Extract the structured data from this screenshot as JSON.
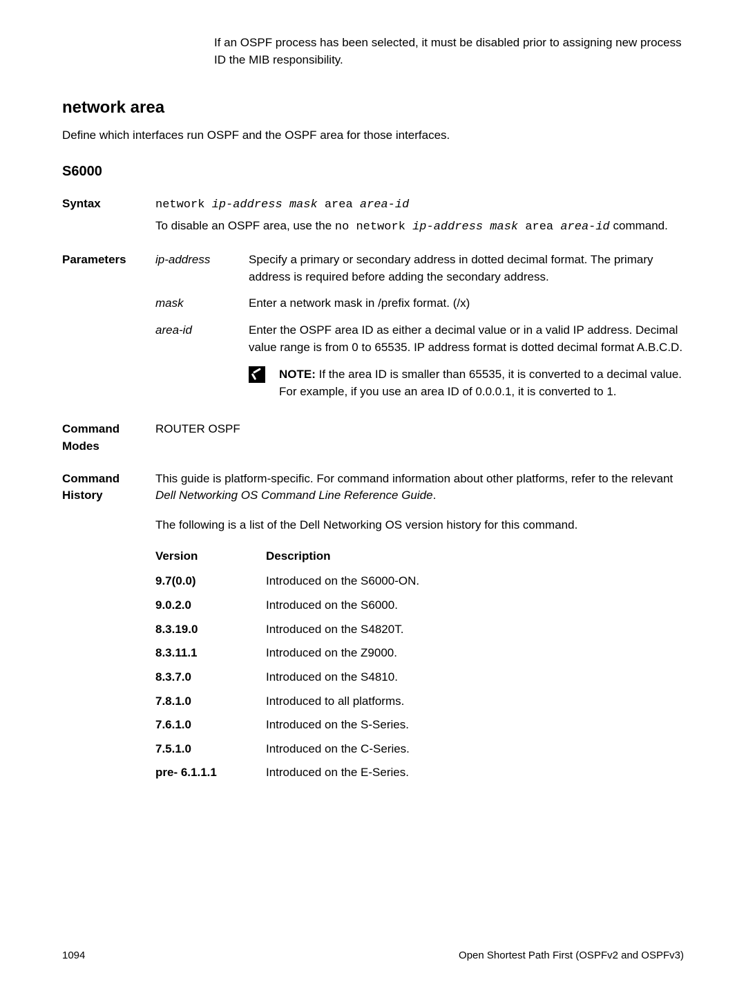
{
  "intro_text": "If an OSPF process has been selected, it must be disabled prior to assigning new process ID the MIB responsibility.",
  "section": {
    "title": "network area",
    "subtitle": "Define which interfaces run OSPF and the OSPF area for those interfaces.",
    "model": "S6000"
  },
  "syntax": {
    "label": "Syntax",
    "cmd_prefix": "network ",
    "cmd_ipmask": "ip-address mask",
    "cmd_area": " area ",
    "cmd_areaid": "area-id",
    "disable_prefix": "To disable an OSPF area, use the ",
    "disable_cmd": "no network ",
    "disable_ipmask": "ip-address mask",
    "disable_area": " area ",
    "disable_areaid": "area-id",
    "disable_suffix": " command."
  },
  "parameters": {
    "label": "Parameters",
    "items": [
      {
        "name": "ip-address",
        "desc": "Specify a primary or secondary address in dotted decimal format. The primary address is required before adding the secondary address."
      },
      {
        "name": "mask",
        "desc": "Enter a network mask in /prefix format. (/x)"
      },
      {
        "name": "area-id",
        "desc": "Enter the OSPF area ID as either a decimal value or in a valid IP address. Decimal value range is from 0 to 65535. IP address format is dotted decimal format A.B.C.D."
      }
    ],
    "note_label": "NOTE:",
    "note_text": " If the area ID is smaller than 65535, it is converted to a decimal value. For example, if you use an area ID of 0.0.0.1, it is converted to 1."
  },
  "command_modes": {
    "label": "Command Modes",
    "value": "ROUTER OSPF"
  },
  "command_history": {
    "label": "Command History",
    "desc1": "This guide is platform-specific. For command information about other platforms, refer to the relevant ",
    "desc1_italic": "Dell Networking OS Command Line Reference Guide",
    "desc1_suffix": ".",
    "desc2": "The following is a list of the Dell Networking OS version history for this command.",
    "header_version": "Version",
    "header_description": "Description",
    "versions": [
      {
        "v": "9.7(0.0)",
        "d": "Introduced on the S6000-ON."
      },
      {
        "v": "9.0.2.0",
        "d": "Introduced on the S6000."
      },
      {
        "v": "8.3.19.0",
        "d": "Introduced on the S4820T."
      },
      {
        "v": "8.3.11.1",
        "d": "Introduced on the Z9000."
      },
      {
        "v": "8.3.7.0",
        "d": "Introduced on the S4810."
      },
      {
        "v": "7.8.1.0",
        "d": "Introduced to all platforms."
      },
      {
        "v": "7.6.1.0",
        "d": "Introduced on the S-Series."
      },
      {
        "v": "7.5.1.0",
        "d": "Introduced on the C-Series."
      },
      {
        "v": "pre- 6.1.1.1",
        "d": "Introduced on the E-Series."
      }
    ]
  },
  "footer": {
    "page": "1094",
    "chapter": "Open Shortest Path First (OSPFv2 and OSPFv3)"
  }
}
